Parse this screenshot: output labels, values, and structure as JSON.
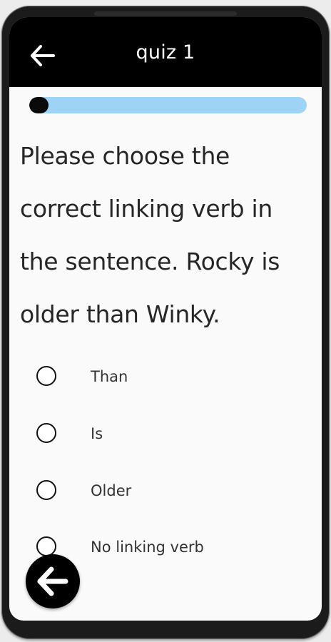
{
  "app_bar": {
    "title": "quiz 1",
    "back_icon": "arrow-left-icon"
  },
  "progress": {
    "fraction": 0.07,
    "track_color": "#9fd3f6",
    "fill_color": "#0a0a0a"
  },
  "question": {
    "text": "Please choose the correct linking verb in the sentence. Rocky is older than Winky."
  },
  "options": [
    {
      "label": "Than",
      "selected": false
    },
    {
      "label": "Is",
      "selected": false
    },
    {
      "label": "Older",
      "selected": false
    },
    {
      "label": "No linking verb",
      "selected": false
    }
  ],
  "fab": {
    "icon": "arrow-left-circle-icon"
  },
  "colors": {
    "app_bar_bg": "#000000",
    "screen_bg": "#fafafa",
    "text": "#262626"
  }
}
